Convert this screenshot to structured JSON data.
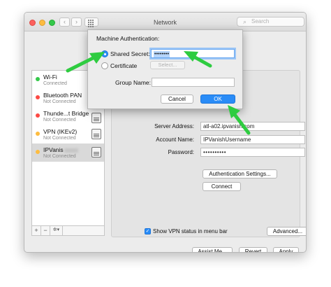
{
  "window": {
    "title": "Network"
  },
  "search": {
    "placeholder": "Search"
  },
  "services": [
    {
      "name": "Wi-Fi",
      "status": "Connected",
      "dot": "#34c84a"
    },
    {
      "name": "Bluetooth PAN",
      "status": "Not Connected",
      "dot": "#fc4a44"
    },
    {
      "name": "Thunde...t Bridge",
      "status": "Not Connected",
      "dot": "#fc4a44"
    },
    {
      "name": "VPN (IKEv2)",
      "status": "Not Connected",
      "dot": "#fdbc40"
    },
    {
      "name": "IPVanis",
      "status": "Not Connected",
      "dot": "#fdbc40"
    }
  ],
  "sidebar_tools": {
    "add": "+",
    "remove": "−",
    "gear": "✲▾"
  },
  "vpn": {
    "server_label": "Server Address:",
    "server_value": "atl-a02.ipvanish.com",
    "account_label": "Account Name:",
    "account_value": "IPVanishUsername",
    "password_label": "Password:",
    "password_value": "••••••••••",
    "auth_settings": "Authentication Settings...",
    "connect": "Connect",
    "show_status": "Show VPN status in menu bar",
    "advanced": "Advanced...",
    "help": "?"
  },
  "footer": {
    "assist": "Assist Me...",
    "revert": "Revert",
    "apply": "Apply"
  },
  "sheet": {
    "title": "Machine Authentication:",
    "shared_secret_label": "Shared Secret:",
    "shared_secret_value": "••••••••",
    "certificate_label": "Certificate",
    "select_label": "Select...",
    "group_label": "Group Name:",
    "cancel": "Cancel",
    "ok": "OK"
  },
  "colors": {
    "accent": "#2a8cf7",
    "arrow": "#2ecc40"
  }
}
